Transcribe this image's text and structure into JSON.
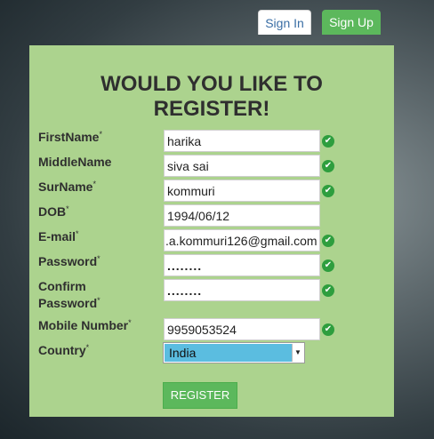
{
  "tabs": {
    "signin": "Sign In",
    "signup": "Sign Up"
  },
  "form": {
    "title_line1": "WOULD YOU LIKE TO",
    "title_line2": "REGISTER!",
    "required_mark": "*",
    "firstname": {
      "label": "FirstName",
      "value": "harika"
    },
    "middlename": {
      "label": "MiddleName",
      "value": "siva sai"
    },
    "surname": {
      "label": "SurName",
      "value": "kommuri"
    },
    "dob": {
      "label": "DOB",
      "value": "1994/06/12"
    },
    "email": {
      "label": "E-mail",
      "value": ".a.kommuri126@gmail.com"
    },
    "password": {
      "label": "Password",
      "value": "........"
    },
    "confirm": {
      "label_line1": "Confirm",
      "label_line2": "Password",
      "value": "........"
    },
    "mobile": {
      "label": "Mobile Number",
      "value": "9959053524"
    },
    "country": {
      "label": "Country",
      "value": "India"
    },
    "submit": "REGISTER",
    "valid_icon": "check-circle-icon"
  }
}
